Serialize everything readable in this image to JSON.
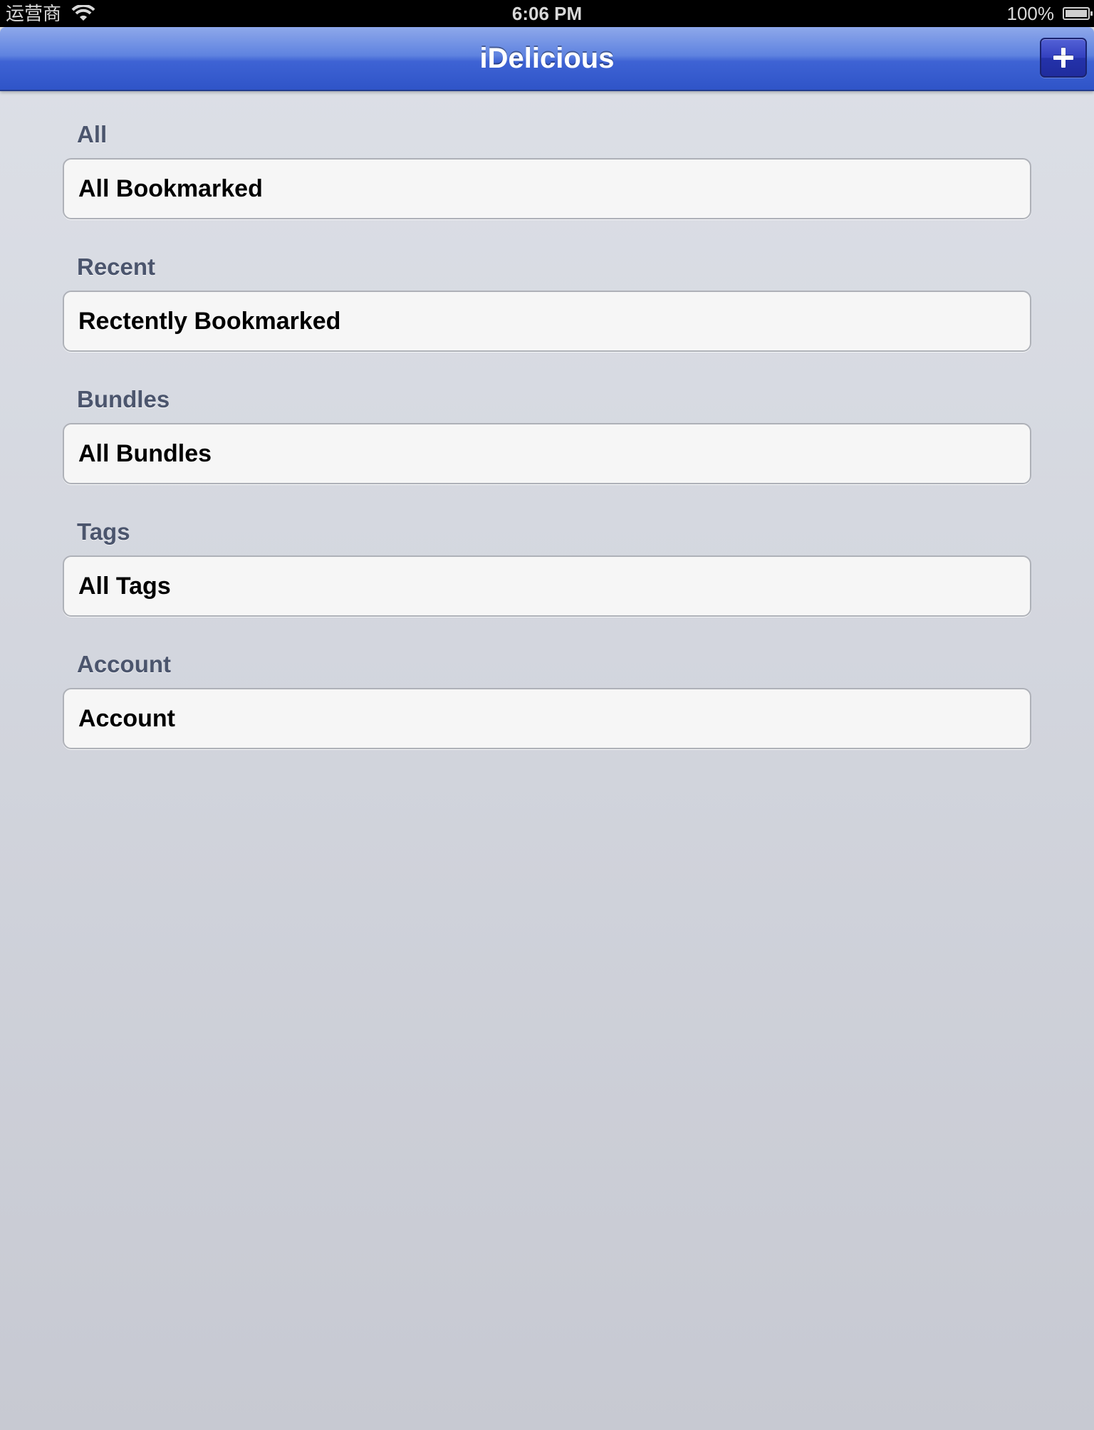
{
  "status_bar": {
    "carrier": "运营商",
    "time": "6:06 PM",
    "battery": "100%"
  },
  "nav_bar": {
    "title": "iDelicious",
    "add_button_icon": "plus-icon"
  },
  "sections": [
    {
      "header": "All",
      "row": "All Bookmarked"
    },
    {
      "header": "Recent",
      "row": "Rectently Bookmarked"
    },
    {
      "header": "Bundles",
      "row": "All Bundles"
    },
    {
      "header": "Tags",
      "row": "All Tags"
    },
    {
      "header": "Account",
      "row": "Account"
    }
  ],
  "colors": {
    "nav_bar": "#3e63d4",
    "add_button": "#2f3cb8",
    "section_header_text": "#4b556d",
    "cell_background": "#f6f6f6"
  }
}
